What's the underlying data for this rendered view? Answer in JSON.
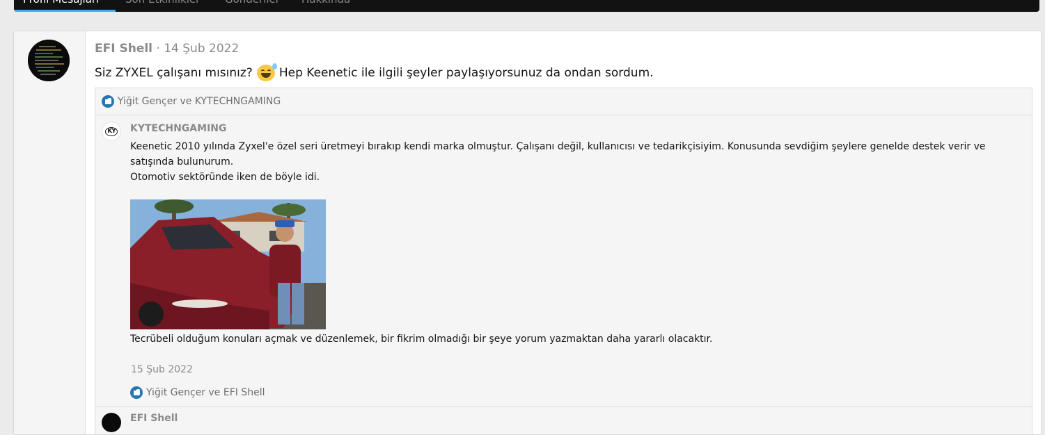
{
  "tabs": [
    {
      "label": "Profil Mesajları",
      "active": true
    },
    {
      "label": "Son Etkinlikler",
      "active": false
    },
    {
      "label": "Gönderiler",
      "active": false
    },
    {
      "label": "Hakkında",
      "active": false
    }
  ],
  "post": {
    "author": "EFI Shell",
    "separator": "·",
    "date": "14 Şub 2022",
    "text_before_emoji": "Siz ZYXEL çalışanı mısınız?",
    "emoji": "sweat-smile-emoji",
    "text_after_emoji": "Hep Keenetic ile ilgili şeyler paylaşıyorsunuz da ondan sordum.",
    "likes": "Yiğit Gençer ve KYTECHNGAMING"
  },
  "comment": {
    "author": "KYTECHNGAMING",
    "line1": "Keenetic 2010 yılında Zyxel'e özel seri üretmeyi bırakıp kendi marka olmuştur. Çalışanı değil, kullanıcısı ve tedarikçisiyim. Konusunda sevdiğim şeylere genelde destek verir ve satışında bulunurum.",
    "line2": "Otomotiv sektöründe iken de böyle idi.",
    "after_image": "Tecrübeli olduğum konuları açmak ve düzenlemek, bir fikrim olmadığı bir şeye yorum yazmaktan daha yararlı olacaktır.",
    "date": "15 Şub 2022",
    "likes": "Yiğit Gençer ve EFI Shell"
  },
  "comment2": {
    "author": "EFI Shell"
  },
  "colors": {
    "accent": "#47a7eb",
    "like_badge": "#2577b1",
    "tab_bar": "#121212"
  }
}
